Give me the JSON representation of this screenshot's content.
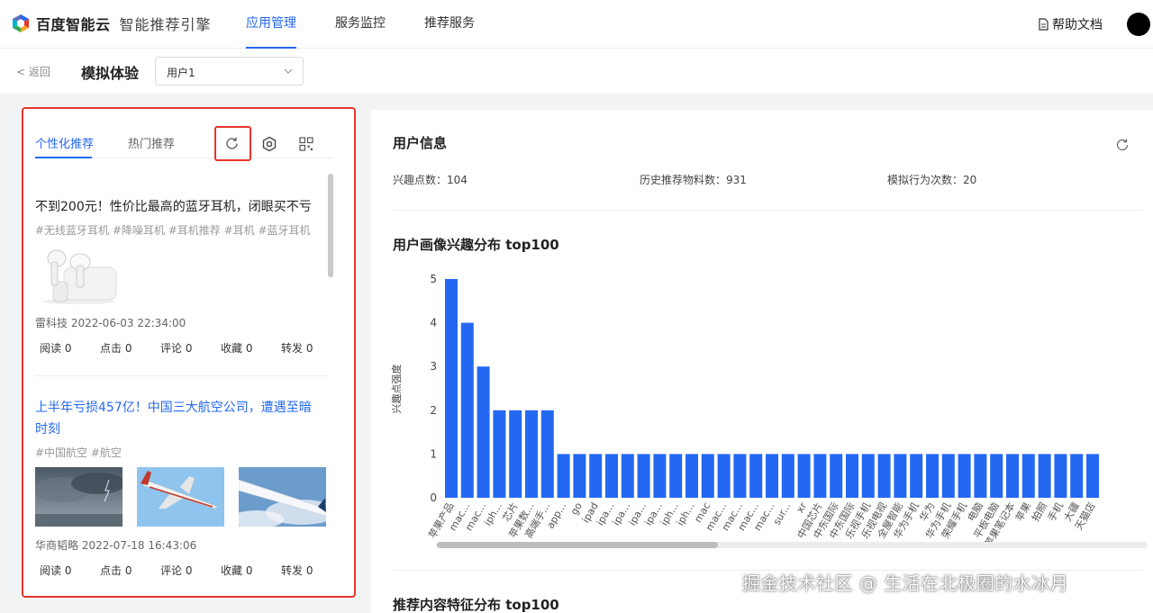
{
  "nav": {
    "brand": "百度智能云",
    "product": "智能推荐引擎",
    "tabs": [
      "应用管理",
      "服务监控",
      "推荐服务"
    ],
    "active_tab": "应用管理",
    "help": "帮助文档"
  },
  "sub": {
    "back": "返回",
    "title": "模拟体验",
    "user_select": "用户1"
  },
  "left": {
    "tabs": [
      "个性化推荐",
      "热门推荐"
    ],
    "cards": [
      {
        "title": "不到200元！性价比最高的蓝牙耳机，闭眼买不亏",
        "tags": "#无线蓝牙耳机 #降噪耳机 #耳机推荐 #耳机 #蓝牙耳机",
        "meta": "雷科技 2022-06-03 22:34:00",
        "stats": [
          "阅读 0",
          "点击 0",
          "评论 0",
          "收藏 0",
          "转发 0"
        ]
      },
      {
        "title": "上半年亏损457亿！中国三大航空公司，遭遇至暗时刻",
        "tags": "#中国航空 #航空",
        "meta": "华商韬略 2022-07-18 16:43:06",
        "stats": [
          "阅读 0",
          "点击 0",
          "评论 0",
          "收藏 0",
          "转发 0"
        ]
      }
    ]
  },
  "right": {
    "user_info_title": "用户信息",
    "info": [
      "兴趣点数：104",
      "历史推荐物料数：931",
      "模拟行为次数：20"
    ],
    "chart_title": "用户画像兴趣分布 top100",
    "next_title": "推荐内容特征分布 top100"
  },
  "chart_data": {
    "type": "bar",
    "title": "用户画像兴趣分布 top100",
    "ylabel": "兴趣点强度",
    "ylim": [
      0,
      5
    ],
    "yticks": [
      "0",
      "1",
      "2",
      "3",
      "4",
      "5"
    ],
    "categories": [
      "苹果产品",
      "mac...",
      "mac...",
      "iph...",
      "芯片",
      "苹果数...",
      "高端手...",
      "app...",
      "go",
      "ipad",
      "ipa...",
      "ipa...",
      "ipa...",
      "ipa...",
      "iph...",
      "iph...",
      "mac",
      "mac...",
      "mac...",
      "mac...",
      "mac...",
      "sur...",
      "xr",
      "中国芯片",
      "中东国际",
      "中东国际",
      "乐视手机",
      "乐视电视",
      "全屋智能",
      "华为手机",
      "华为",
      "华为手机",
      "荣耀手机",
      "电脑",
      "平板电脑",
      "苹果笔记本",
      "苹果",
      "拍照",
      "手机",
      "大疆",
      "天猫店"
    ],
    "values": [
      5,
      4,
      3,
      2,
      2,
      2,
      2,
      1,
      1,
      1,
      1,
      1,
      1,
      1,
      1,
      1,
      1,
      1,
      1,
      1,
      1,
      1,
      1,
      1,
      1,
      1,
      1,
      1,
      1,
      1,
      1,
      1,
      1,
      1,
      1,
      1,
      1,
      1,
      1,
      1,
      1
    ],
    "bar_color": "#2468f2",
    "grid": true
  },
  "colors": {
    "accent": "#2468f2",
    "highlight_box": "#e8352b"
  },
  "watermark": "掘金技术社区 @ 生活在北极圈的水冰月"
}
